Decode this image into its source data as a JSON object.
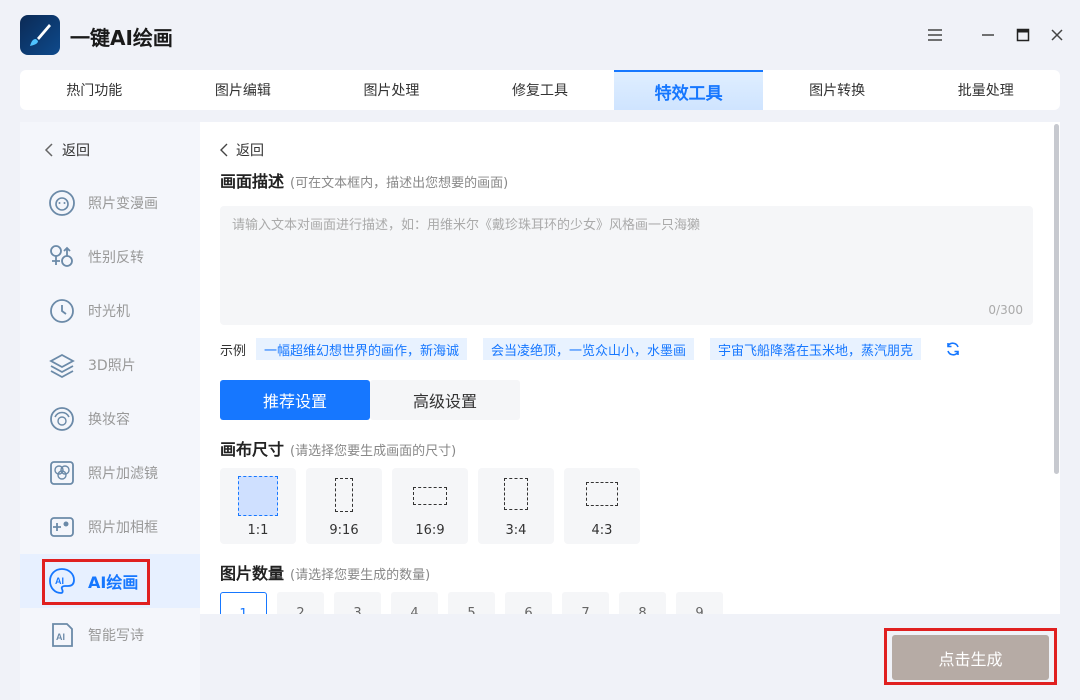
{
  "app": {
    "title": "一键AI绘画"
  },
  "tabs": [
    {
      "label": "热门功能"
    },
    {
      "label": "图片编辑"
    },
    {
      "label": "图片处理"
    },
    {
      "label": "修复工具"
    },
    {
      "label": "特效工具"
    },
    {
      "label": "图片转换"
    },
    {
      "label": "批量处理"
    }
  ],
  "active_tab": "特效工具",
  "sidebar": {
    "back_label": "返回",
    "items": [
      {
        "label": "照片变漫画",
        "icon": "cartoon-face-icon"
      },
      {
        "label": "性别反转",
        "icon": "gender-icon"
      },
      {
        "label": "时光机",
        "icon": "clock-icon"
      },
      {
        "label": "3D照片",
        "icon": "layers-icon"
      },
      {
        "label": "换妆容",
        "icon": "makeup-face-icon"
      },
      {
        "label": "照片加滤镜",
        "icon": "filter-icon"
      },
      {
        "label": "照片加相框",
        "icon": "frame-icon"
      },
      {
        "label": "AI绘画",
        "icon": "ai-palette-icon"
      },
      {
        "label": "智能写诗",
        "icon": "ai-document-icon"
      }
    ]
  },
  "main": {
    "back_label": "返回",
    "description": {
      "title": "画面描述",
      "hint": "(可在文本框内，描述出您想要的画面)",
      "placeholder": "请输入文本对画面进行描述，如：用维米尔《戴珍珠耳环的少女》风格画一只海獭",
      "counter": "0/300"
    },
    "examples": {
      "label": "示例",
      "items": [
        "一幅超维幻想世界的画作，新海诚",
        "会当凌绝顶，一览众山小，水墨画",
        "宇宙飞船降落在玉米地，蒸汽朋克"
      ]
    },
    "settings_tabs": {
      "recommended": "推荐设置",
      "advanced": "高级设置"
    },
    "canvas": {
      "title": "画布尺寸",
      "hint": "(请选择您要生成画面的尺寸)",
      "ratios": [
        "1:1",
        "9:16",
        "16:9",
        "3:4",
        "4:3"
      ],
      "selected": "1:1"
    },
    "count": {
      "title": "图片数量",
      "hint": "(请选择您要生成的数量)",
      "options": [
        "1",
        "2",
        "3",
        "4",
        "5",
        "6",
        "7",
        "8",
        "9"
      ],
      "selected": "1"
    }
  },
  "generate_button": "点击生成",
  "colors": {
    "accent": "#1677ff",
    "highlight_box": "#e02020",
    "generate_button": "#b6aba5"
  }
}
